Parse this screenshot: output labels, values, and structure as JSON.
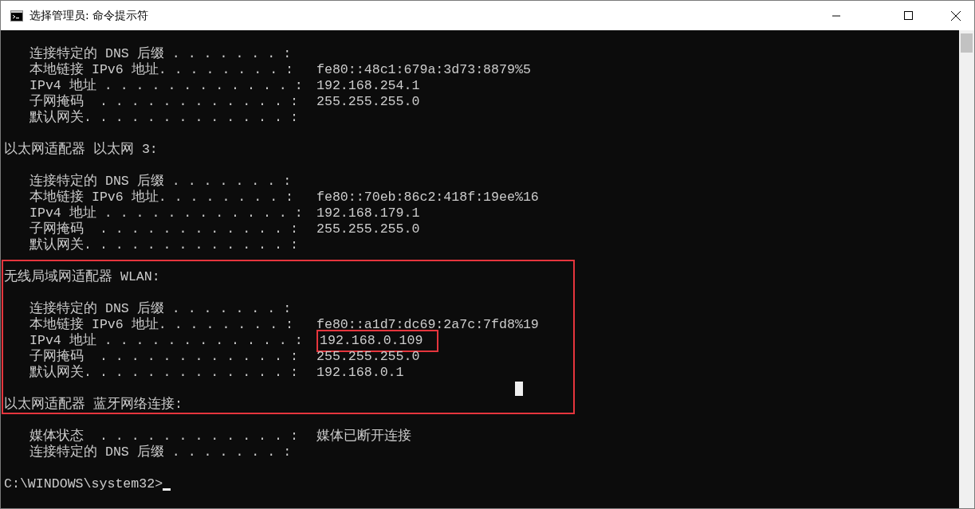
{
  "window": {
    "title": "选择管理员: 命令提示符"
  },
  "console": {
    "blocks": [
      {
        "outlined": false,
        "lines": [
          {
            "kind": "entry",
            "label": "连接特定的 DNS 后缀 . . . . . . . :"
          },
          {
            "kind": "entry",
            "label": "本地链接 IPv6 地址. . . . . . . . :",
            "value": "fe80::48c1:679a:3d73:8879%5"
          },
          {
            "kind": "entry",
            "label": "IPv4 地址 . . . . . . . . . . . . :",
            "value": "192.168.254.1"
          },
          {
            "kind": "entry",
            "label": "子网掩码  . . . . . . . . . . . . :",
            "value": "255.255.255.0"
          },
          {
            "kind": "entry",
            "label": "默认网关. . . . . . . . . . . . . :"
          },
          {
            "kind": "blank"
          },
          {
            "kind": "header",
            "label": "以太网适配器 以太网 3:"
          },
          {
            "kind": "blank"
          },
          {
            "kind": "entry",
            "label": "连接特定的 DNS 后缀 . . . . . . . :"
          },
          {
            "kind": "entry",
            "label": "本地链接 IPv6 地址. . . . . . . . :",
            "value": "fe80::70eb:86c2:418f:19ee%16"
          },
          {
            "kind": "entry",
            "label": "IPv4 地址 . . . . . . . . . . . . :",
            "value": "192.168.179.1"
          },
          {
            "kind": "entry",
            "label": "子网掩码  . . . . . . . . . . . . :",
            "value": "255.255.255.0"
          },
          {
            "kind": "entry",
            "label": "默认网关. . . . . . . . . . . . . :"
          },
          {
            "kind": "blank"
          }
        ]
      },
      {
        "outlined": true,
        "lines": [
          {
            "kind": "header",
            "label": "无线局域网适配器 WLAN:"
          },
          {
            "kind": "blank"
          },
          {
            "kind": "entry",
            "label": "连接特定的 DNS 后缀 . . . . . . . :"
          },
          {
            "kind": "entry",
            "label": "本地链接 IPv6 地址. . . . . . . . :",
            "value": "fe80::a1d7:dc69:2a7c:7fd8%19"
          },
          {
            "kind": "entry",
            "label": "IPv4 地址 . . . . . . . . . . . . :",
            "value": "192.168.0.109",
            "value_outlined": true
          },
          {
            "kind": "entry",
            "label": "子网掩码  . . . . . . . . . . . . :",
            "value": "255.255.255.0"
          },
          {
            "kind": "entry",
            "label": "默认网关. . . . . . . . . . . . . :",
            "value": "192.168.0.1"
          },
          {
            "kind": "cursor"
          },
          {
            "kind": "header",
            "label": "以太网适配器 蓝牙网络连接:"
          }
        ]
      },
      {
        "outlined": false,
        "lines": [
          {
            "kind": "blank"
          },
          {
            "kind": "entry",
            "label": "媒体状态  . . . . . . . . . . . . :",
            "value": "媒体已断开连接"
          },
          {
            "kind": "entry",
            "label": "连接特定的 DNS 后缀 . . . . . . . :"
          },
          {
            "kind": "blank"
          },
          {
            "kind": "prompt",
            "label": "C:\\WINDOWS\\system32>"
          }
        ]
      }
    ]
  }
}
